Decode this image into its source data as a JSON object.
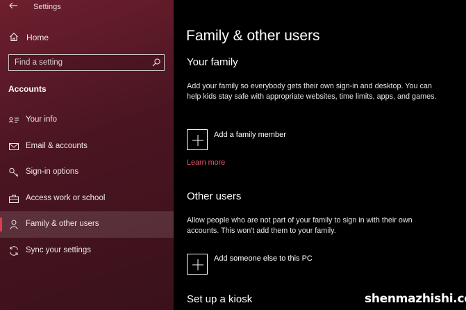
{
  "app": {
    "title": "Settings"
  },
  "sidebar": {
    "home_label": "Home",
    "search_placeholder": "Find a setting",
    "section_label": "Accounts",
    "items": [
      {
        "label": "Your info",
        "icon": "contact-card-icon"
      },
      {
        "label": "Email & accounts",
        "icon": "mail-icon"
      },
      {
        "label": "Sign-in options",
        "icon": "key-icon"
      },
      {
        "label": "Access work or school",
        "icon": "briefcase-icon"
      },
      {
        "label": "Family & other users",
        "icon": "person-icon",
        "selected": true
      },
      {
        "label": "Sync your settings",
        "icon": "sync-icon"
      }
    ]
  },
  "main": {
    "page_title": "Family & other users",
    "your_family": {
      "heading": "Your family",
      "description": "Add your family so everybody gets their own sign-in and desktop. You can help kids stay safe with appropriate websites, time limits, apps, and games.",
      "add_label": "Add a family member",
      "learn_more": "Learn more"
    },
    "other_users": {
      "heading": "Other users",
      "description": "Allow people who are not part of your family to sign in with their own accounts. This won't add them to your family.",
      "add_label": "Add someone else to this PC"
    },
    "kiosk": {
      "heading": "Set up a kiosk"
    }
  },
  "watermark": "shenmazhishi.com",
  "colors": {
    "accent": "#e23a52",
    "link": "#e8596d",
    "sidebar_bg": "#4a1521"
  }
}
